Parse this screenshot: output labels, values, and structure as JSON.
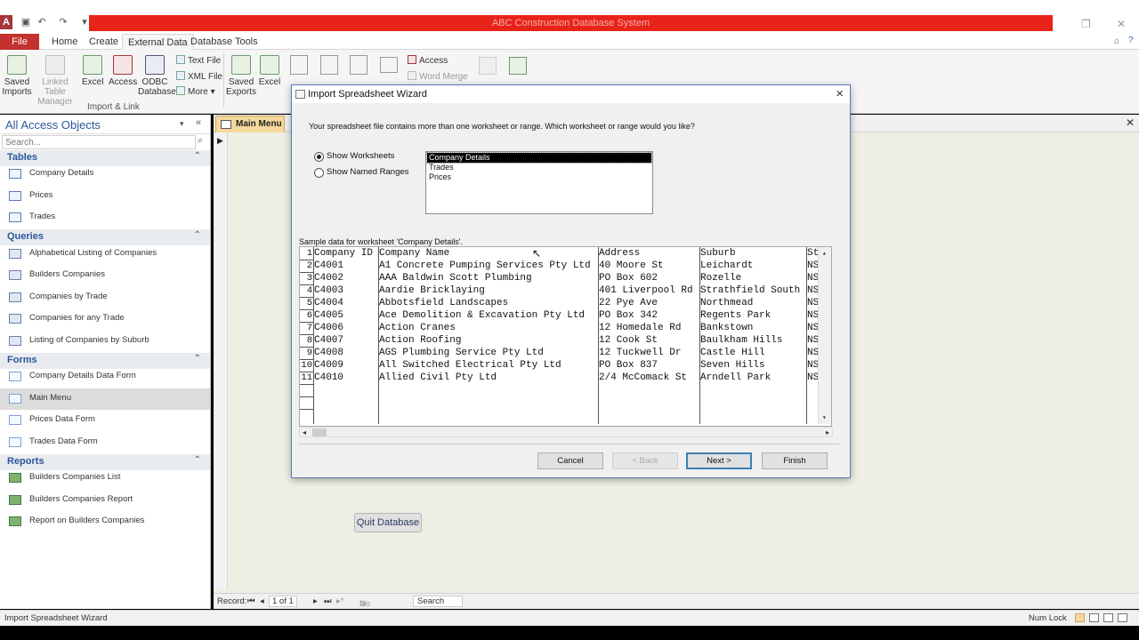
{
  "app": {
    "window_title": "ABC Construction Database System"
  },
  "ribbon": {
    "tabs": [
      "File",
      "Home",
      "Create",
      "External Data",
      "Database Tools"
    ],
    "buttons": {
      "saved_imports": "Saved\nImports",
      "linked_table_manager": "Linked Table\nManager",
      "excel_import": "Excel",
      "access_import": "Access",
      "odbc_database": "ODBC\nDatabase",
      "text_file": "Text File",
      "xml_file": "XML File",
      "more": "More",
      "saved_exports": "Saved\nExports",
      "excel_export": "Excel",
      "access_export": "Access",
      "word_merge": "Word Merge"
    },
    "group_label": "Import & Link"
  },
  "nav": {
    "title": "All Access Objects",
    "search_placeholder": "Search...",
    "sections": {
      "tables": {
        "label": "Tables",
        "items": [
          "Company Details",
          "Prices",
          "Trades"
        ]
      },
      "queries": {
        "label": "Queries",
        "items": [
          "Alphabetical Listing of Companies",
          "Builders Companies",
          "Companies by Trade",
          "Companies for any Trade",
          "Listing of Companies by Suburb"
        ]
      },
      "forms": {
        "label": "Forms",
        "items": [
          "Company Details Data Form",
          "Main Menu",
          "Prices Data Form",
          "Trades Data Form"
        ]
      },
      "reports": {
        "label": "Reports",
        "items": [
          "Builders Companies List",
          "Builders Companies Report",
          "Report on Builders Companies"
        ]
      }
    }
  },
  "document": {
    "tab_label": "Main Menu",
    "quit_button": "Quit Database",
    "record_bar": {
      "label": "Record:",
      "position": "1 of 1",
      "filter": "No Filter",
      "search": "Search"
    }
  },
  "dialog": {
    "title": "Import Spreadsheet Wizard",
    "question": "Your spreadsheet file contains more than one worksheet or range. Which worksheet or range would you like?",
    "options": {
      "show_worksheets": "Show Worksheets",
      "show_named_ranges": "Show Named Ranges",
      "selected": "show_worksheets"
    },
    "worksheets": [
      "Company Details",
      "Trades",
      "Prices"
    ],
    "selected_worksheet": "Company Details",
    "sample_label": "Sample data for worksheet 'Company Details'.",
    "sample": {
      "rows": [
        [
          "Company ID",
          "Company Name",
          "Address",
          "Suburb",
          "St"
        ],
        [
          "C4001",
          "A1 Concrete Pumping Services Pty Ltd",
          "40 Moore St",
          "Leichardt",
          "NS"
        ],
        [
          "C4002",
          "AAA Baldwin Scott Plumbing",
          "PO Box 602",
          "Rozelle",
          "NS"
        ],
        [
          "C4003",
          "Aardie Bricklaying",
          "401 Liverpool Rd",
          "Strathfield South",
          "NS"
        ],
        [
          "C4004",
          "Abbotsfield Landscapes",
          "22 Pye Ave",
          "Northmead",
          "NS"
        ],
        [
          "C4005",
          "Ace Demolition & Excavation Pty Ltd",
          "PO Box 342",
          "Regents Park",
          "NS"
        ],
        [
          "C4006",
          "Action Cranes",
          "12 Homedale Rd",
          "Bankstown",
          "NS"
        ],
        [
          "C4007",
          "Action Roofing",
          "12 Cook St",
          "Baulkham Hills",
          "NS"
        ],
        [
          "C4008",
          "AGS Plumbing Service Pty Ltd",
          "12 Tuckwell Dr",
          "Castle Hill",
          "NS"
        ],
        [
          "C4009",
          "All Switched Electrical Pty Ltd",
          "PO Box 837",
          "Seven Hills",
          "NS"
        ],
        [
          "C4010",
          "Allied Civil Pty Ltd",
          "2/4 McComack St",
          "Arndell Park",
          "NS"
        ]
      ]
    },
    "buttons": {
      "cancel": "Cancel",
      "back": "< Back",
      "next": "Next >",
      "finish": "Finish"
    }
  },
  "statusbar": {
    "left": "Import Spreadsheet Wizard",
    "num_lock": "Num Lock"
  }
}
